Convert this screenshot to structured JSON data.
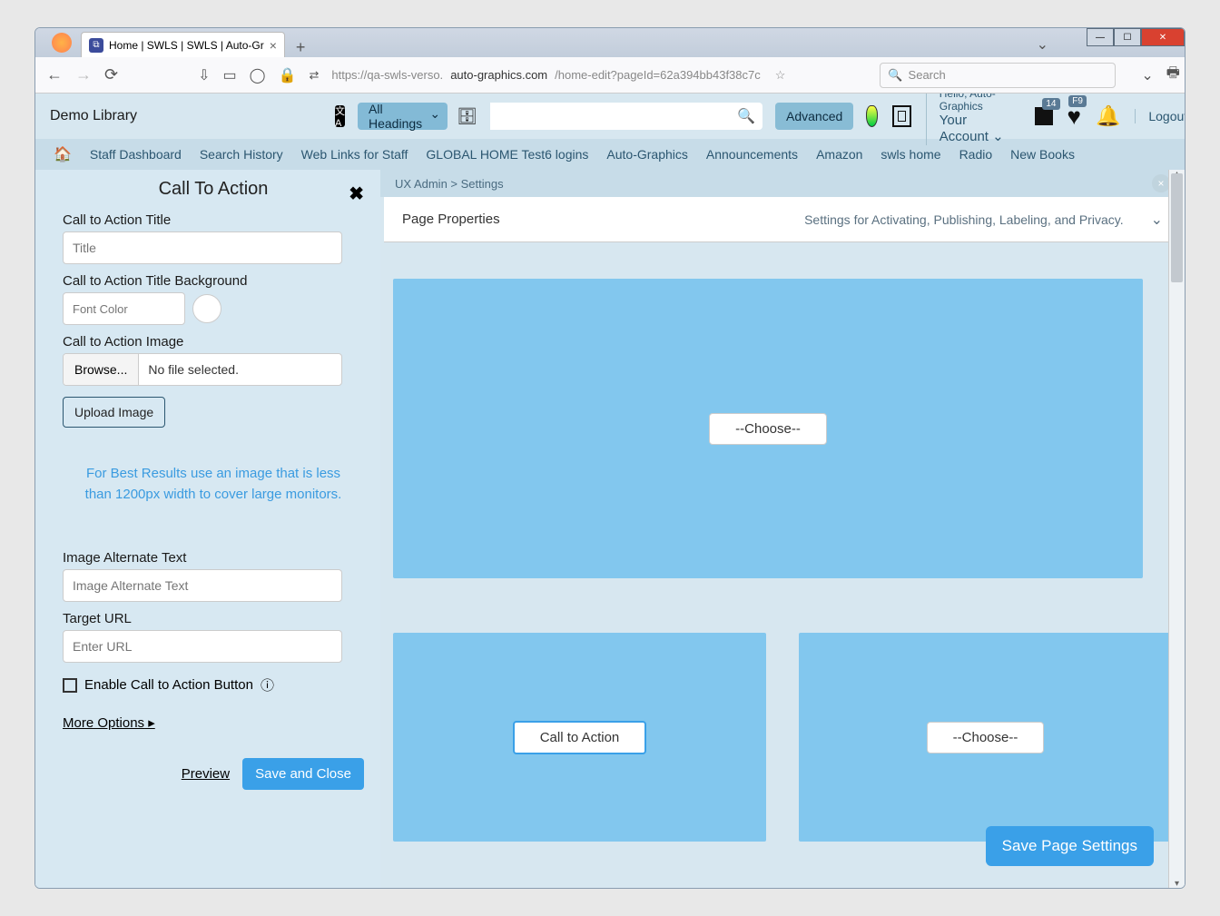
{
  "browser": {
    "tab_title": "Home | SWLS | SWLS | Auto-Gr",
    "url_prefix": "https://qa-swls-verso.",
    "url_domain": "auto-graphics.com",
    "url_path": "/home-edit?pageId=62a394bb43f38c7c",
    "search_placeholder": "Search"
  },
  "app_header": {
    "library_name": "Demo Library",
    "headings_dropdown": "All Headings",
    "advanced": "Advanced",
    "greeting": "Hello, Auto-Graphics",
    "account_label": "Your Account",
    "logout": "Logout",
    "badge_cards": "14",
    "badge_heart": "F9"
  },
  "nav": {
    "items": [
      "Staff Dashboard",
      "Search History",
      "Web Links for Staff",
      "GLOBAL HOME Test6 logins",
      "Auto-Graphics",
      "Announcements",
      "Amazon",
      "swls home",
      "Radio",
      "New Books"
    ]
  },
  "sidebar": {
    "title": "Call To Action",
    "fields": {
      "cta_title_label": "Call to Action Title",
      "cta_title_placeholder": "Title",
      "bg_label": "Call to Action Title Background",
      "font_color_placeholder": "Font Color",
      "image_label": "Call to Action Image",
      "browse": "Browse...",
      "no_file": "No file selected.",
      "upload_btn": "Upload Image",
      "hint": "For Best Results use an image that is less than 1200px width to cover large monitors.",
      "alt_label": "Image Alternate Text",
      "alt_placeholder": "Image Alternate Text",
      "target_label": "Target URL",
      "target_placeholder": "Enter URL",
      "enable_btn_label": "Enable Call to Action Button",
      "more_options": "More Options",
      "preview": "Preview",
      "save_close": "Save and Close"
    }
  },
  "main": {
    "breadcrumb_a": "UX Admin",
    "breadcrumb_b": "Settings",
    "prop_title": "Page Properties",
    "prop_desc": "Settings for Activating, Publishing, Labeling, and Privacy.",
    "block1_label": "--Choose--",
    "block2_label": "Call to Action",
    "block3_label": "--Choose--",
    "save_page": "Save Page Settings"
  }
}
